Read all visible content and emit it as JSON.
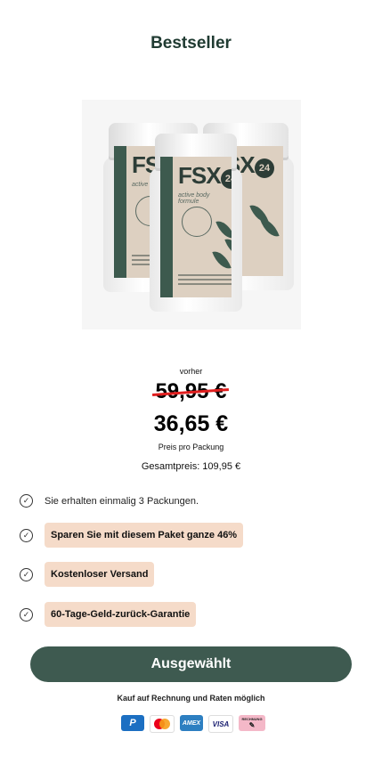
{
  "header": {
    "title": "Bestseller"
  },
  "product": {
    "brand": "FSX",
    "badge": "24",
    "formula": "active body formule"
  },
  "pricing": {
    "before_label": "vorher",
    "old_price": "59,95 €",
    "new_price": "36,65 €",
    "per_pack_label": "Preis pro Packung",
    "total_label": "Gesamtpreis: 109,95 €"
  },
  "features": [
    {
      "text": "Sie erhalten einmalig 3 Packungen.",
      "highlighted": false
    },
    {
      "text": "Sparen Sie mit diesem Paket ganze 46%",
      "highlighted": true
    },
    {
      "text": "Kostenloser Versand",
      "highlighted": true
    },
    {
      "text": "60-Tage-Geld-zurück-Garantie",
      "highlighted": true
    }
  ],
  "cta": {
    "label": "Ausgewählt"
  },
  "payment": {
    "note": "Kauf auf Rechnung und Raten möglich",
    "methods": [
      {
        "icon": "paypal-icon",
        "label": "P",
        "color": "#1c6fc2"
      },
      {
        "icon": "mastercard-icon",
        "label": "",
        "color": "#ffffff"
      },
      {
        "icon": "amex-icon",
        "label": "AMEX",
        "color": "#2d7fc1"
      },
      {
        "icon": "visa-icon",
        "label": "VISA",
        "color": "#ffffff"
      },
      {
        "icon": "rechnung-icon",
        "label": "RECHNUNG",
        "color": "#f4b8c8"
      }
    ]
  },
  "colors": {
    "accent": "#3e5a50",
    "title": "#203b32",
    "pill": "#f5dbc9",
    "strike": "#e01e1e"
  }
}
